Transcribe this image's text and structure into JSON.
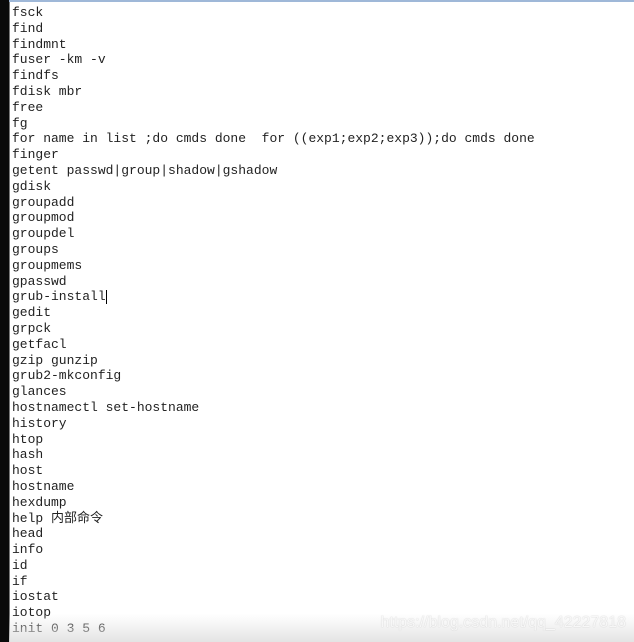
{
  "editor": {
    "lines": [
      "fsck",
      "find",
      "findmnt",
      "fuser -km -v",
      "findfs",
      "fdisk mbr",
      "free",
      "fg",
      "for name in list ;do cmds done  for ((exp1;exp2;exp3));do cmds done",
      "finger",
      "getent passwd|group|shadow|gshadow",
      "gdisk",
      "groupadd",
      "groupmod",
      "groupdel",
      "groups",
      "groupmems",
      "gpasswd",
      "grub-install",
      "gedit",
      "grpck",
      "getfacl",
      "gzip gunzip",
      "grub2-mkconfig",
      "glances",
      "hostnamectl set-hostname",
      "history",
      "htop",
      "hash",
      "host",
      "hostname",
      "hexdump",
      "help 内部命令",
      "head",
      "info",
      "id",
      "if",
      "iostat",
      "iotop",
      "init 0 3 5 6"
    ],
    "caret_line": 18
  },
  "watermark": "https://blog.csdn.net/qq_42227818"
}
